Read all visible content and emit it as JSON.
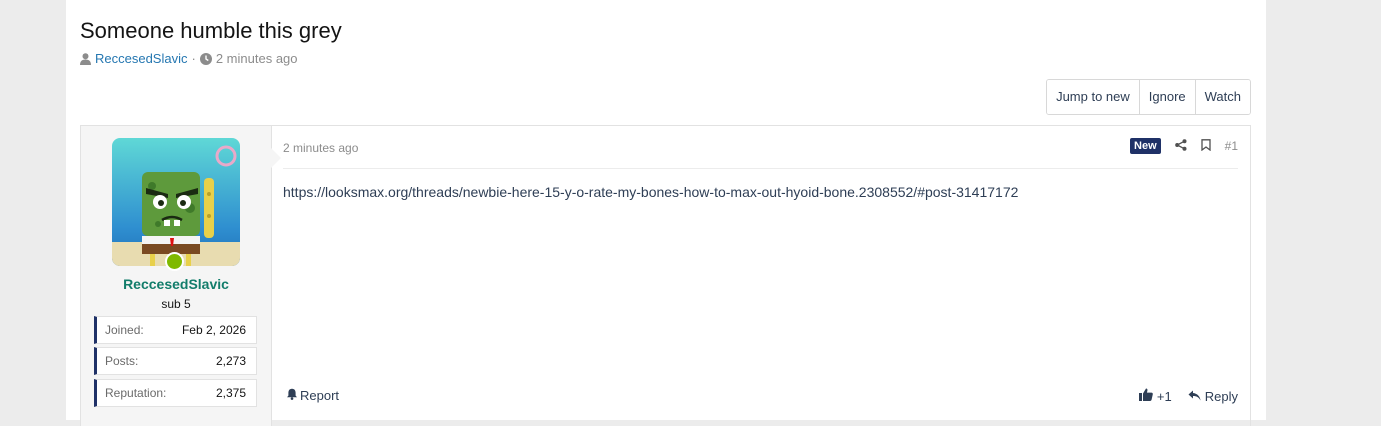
{
  "thread": {
    "title": "Someone humble this grey",
    "author": "ReccesedSlavic",
    "separator": "·",
    "time": "2 minutes ago"
  },
  "actions": {
    "jump_to_new": "Jump to new",
    "ignore": "Ignore",
    "watch": "Watch"
  },
  "post": {
    "user": {
      "name": "ReccesedSlavic",
      "title": "sub 5",
      "online": true,
      "stats": [
        {
          "label": "Joined:",
          "value": "Feb 2, 2026"
        },
        {
          "label": "Posts:",
          "value": "2,273"
        },
        {
          "label": "Reputation:",
          "value": "2,375"
        }
      ]
    },
    "date": "2 minutes ago",
    "badge": "New",
    "number": "#1",
    "body_link": "https://looksmax.org/threads/newbie-here-15-y-o-rate-my-bones-how-to-max-out-hyoid-bone.2308552/#post-31417172",
    "report": "Report",
    "reaction_count": "+1",
    "reply": "Reply"
  },
  "colors": {
    "accent": "#1f3167",
    "username": "#127d6b",
    "link": "#2e3e55",
    "online": "#7fb900"
  }
}
